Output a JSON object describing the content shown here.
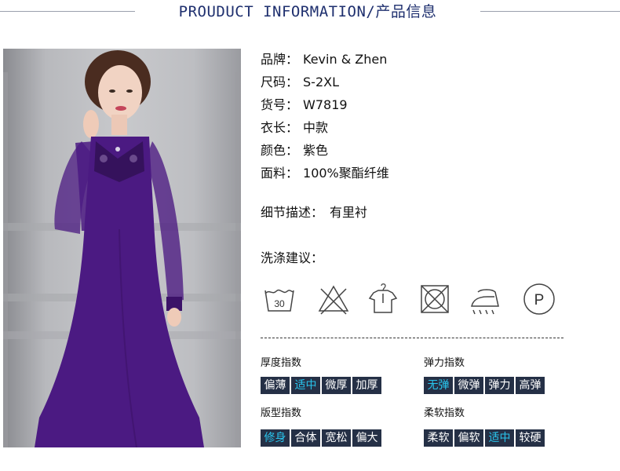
{
  "header": {
    "title": "PROUDUCT INFORMATION/产品信息"
  },
  "info": [
    {
      "key": "品牌：",
      "value": "Kevin & Zhen"
    },
    {
      "key": "尺码：",
      "value": "S-2XL"
    },
    {
      "key": "货号：",
      "value": "W7819"
    },
    {
      "key": "衣长：",
      "value": "中款"
    },
    {
      "key": "颜色：",
      "value": "紫色"
    },
    {
      "key": "面料：",
      "value": "100%聚酯纤维"
    }
  ],
  "detail": {
    "key": "细节描述：",
    "value": "有里衬"
  },
  "wash": {
    "title": "洗涤建议：",
    "icons": [
      "wash-30-icon",
      "do-not-bleach-icon",
      "hang-dry-icon",
      "do-not-tumble-dry-icon",
      "iron-low-icon",
      "dry-clean-p-icon"
    ],
    "wash_temp": "30",
    "dry_clean_letter": "P"
  },
  "indices": {
    "thickness": {
      "label": "厚度指数",
      "options": [
        "偏薄",
        "适中",
        "微厚",
        "加厚"
      ],
      "selected": 1
    },
    "elasticity": {
      "label": "弹力指数",
      "options": [
        "无弹",
        "微弹",
        "弹力",
        "高弹"
      ],
      "selected": 0
    },
    "fit": {
      "label": "版型指数",
      "options": [
        "修身",
        "合体",
        "宽松",
        "偏大"
      ],
      "selected": 0
    },
    "softness": {
      "label": "柔软指数",
      "options": [
        "柔软",
        "偏软",
        "适中",
        "较硬"
      ],
      "selected": 2
    }
  },
  "colors": {
    "title": "#1e2f6e",
    "chip_bg": "#253046",
    "chip_text": "#ffffff",
    "chip_selected_text": "#29c4ec",
    "dress": "#4b1a82"
  }
}
